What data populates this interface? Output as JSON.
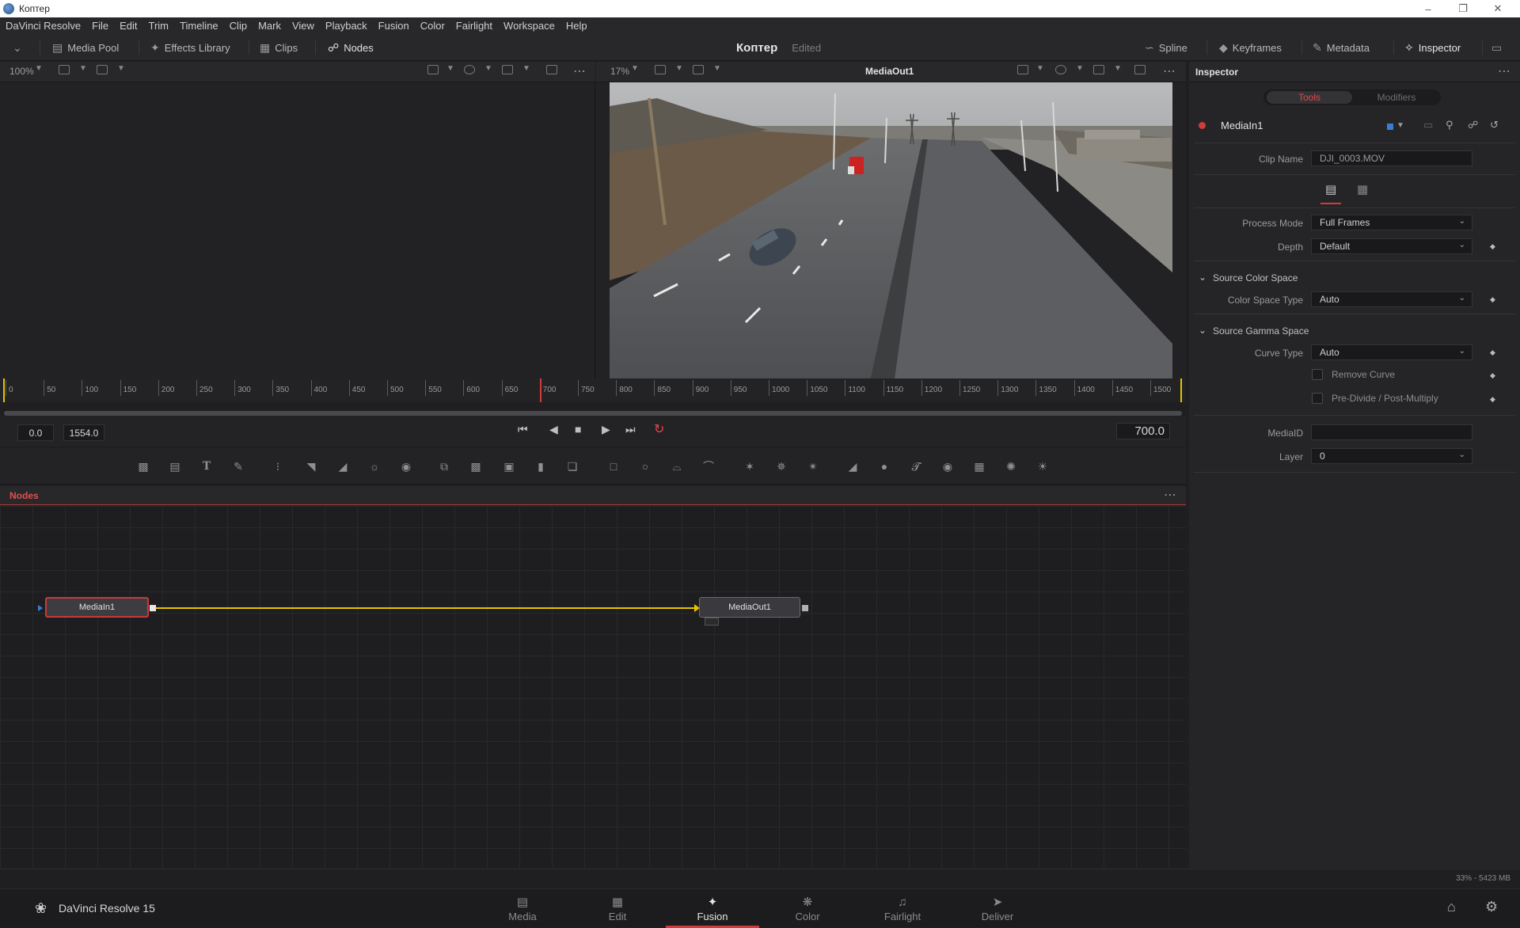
{
  "window": {
    "title": "Коптер"
  },
  "menu": [
    "DaVinci Resolve",
    "File",
    "Edit",
    "Trim",
    "Timeline",
    "Clip",
    "Mark",
    "View",
    "Playback",
    "Fusion",
    "Color",
    "Fairlight",
    "Workspace",
    "Help"
  ],
  "toolbar": {
    "media_pool": "Media Pool",
    "effects_library": "Effects Library",
    "clips": "Clips",
    "nodes": "Nodes",
    "project_name": "Коптер",
    "project_status": "Edited",
    "spline": "Spline",
    "keyframes": "Keyframes",
    "metadata": "Metadata",
    "inspector": "Inspector"
  },
  "viewer_left": {
    "zoom": "100%"
  },
  "viewer_right": {
    "zoom": "17%",
    "title": "MediaOut1"
  },
  "timeline": {
    "ruler_labels": [
      "0",
      "50",
      "100",
      "150",
      "200",
      "250",
      "300",
      "350",
      "400",
      "450",
      "500",
      "550",
      "600",
      "650",
      "700",
      "750",
      "800",
      "850",
      "900",
      "950",
      "1000",
      "1050",
      "1100",
      "1150",
      "1200",
      "1250",
      "1300",
      "1350",
      "1400",
      "1450",
      "1500"
    ],
    "start": "0.0",
    "end": "1554.0",
    "current": "700.0",
    "playhead_frame": 700,
    "total_frames": 1554
  },
  "nodes_panel": {
    "title": "Nodes",
    "nodes": [
      {
        "label": "MediaIn1",
        "selected": true
      },
      {
        "label": "MediaOut1",
        "selected": false
      }
    ]
  },
  "inspector": {
    "title": "Inspector",
    "tabs": [
      "Tools",
      "Modifiers"
    ],
    "active_tab": "Tools",
    "tool_name": "MediaIn1",
    "clip_name_label": "Clip Name",
    "clip_name": "DJI_0003.MOV",
    "process_mode_label": "Process Mode",
    "process_mode": "Full Frames",
    "depth_label": "Depth",
    "depth": "Default",
    "source_color_space": "Source Color Space",
    "color_space_type_label": "Color Space Type",
    "color_space_type": "Auto",
    "source_gamma_space": "Source Gamma Space",
    "curve_type_label": "Curve Type",
    "curve_type": "Auto",
    "remove_curve": "Remove Curve",
    "pre_divide": "Pre-Divide / Post-Multiply",
    "mediaid_label": "MediaID",
    "mediaid": "",
    "layer_label": "Layer",
    "layer": "0"
  },
  "status": {
    "memory": "33% - 5423 MB"
  },
  "pages": {
    "app_name": "DaVinci Resolve 15",
    "items": [
      "Media",
      "Edit",
      "Fusion",
      "Color",
      "Fairlight",
      "Deliver"
    ],
    "active": "Fusion"
  },
  "colors": {
    "accent_red": "#d23b3b",
    "link_yellow": "#e6c200"
  }
}
